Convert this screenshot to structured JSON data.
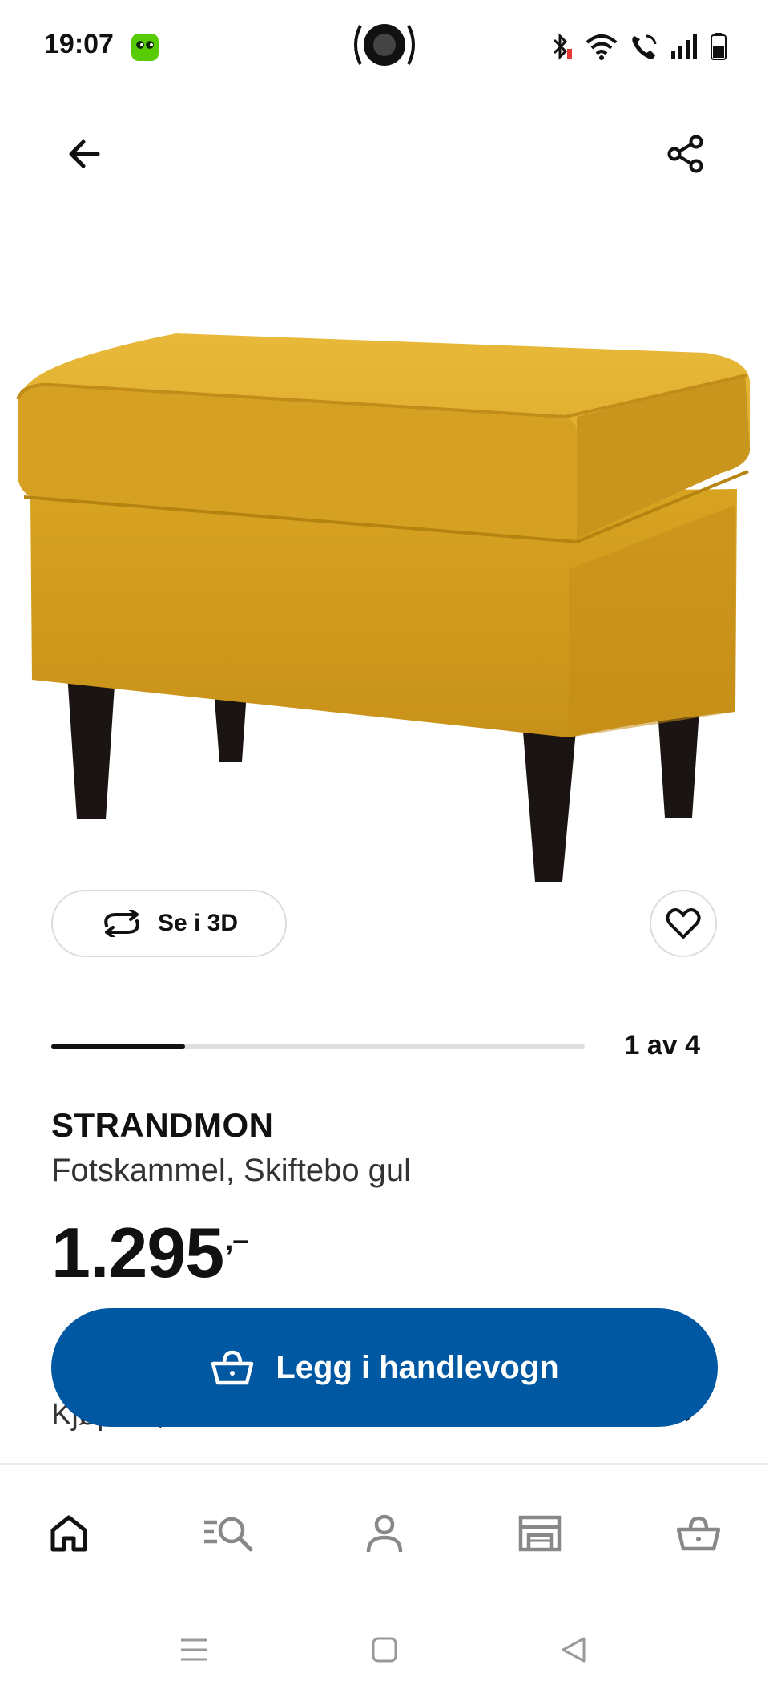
{
  "status_bar": {
    "time": "19:07",
    "icons": [
      "duolingo-app-icon",
      "media-badge-icon",
      "bluetooth-icon",
      "wifi-icon",
      "wifi-call-icon",
      "signal-icon",
      "battery-icon"
    ]
  },
  "top_bar": {
    "back_icon": "arrow-left-icon",
    "share_icon": "share-icon"
  },
  "product": {
    "view_3d_label": "Se i 3D",
    "image_counter": "1 av 4",
    "carousel_progress": 0.25,
    "name": "STRANDMON",
    "description": "Fotskammel, Skiftebo gul",
    "price": "1.295",
    "price_suffix": ",–",
    "partially_hidden_text": "Kjøp nå, betal senere"
  },
  "actions": {
    "add_to_cart_label": "Legg i handlevogn"
  },
  "bottom_nav": {
    "items": [
      {
        "name": "home",
        "icon": "home-icon",
        "active": true
      },
      {
        "name": "search",
        "icon": "search-list-icon",
        "active": false
      },
      {
        "name": "profile",
        "icon": "person-icon",
        "active": false
      },
      {
        "name": "stores",
        "icon": "store-icon",
        "active": false
      },
      {
        "name": "cart",
        "icon": "basket-icon",
        "active": false
      }
    ]
  },
  "colors": {
    "accent": "#0058a3",
    "product_yellow": "#d9a622",
    "text": "#111111"
  }
}
